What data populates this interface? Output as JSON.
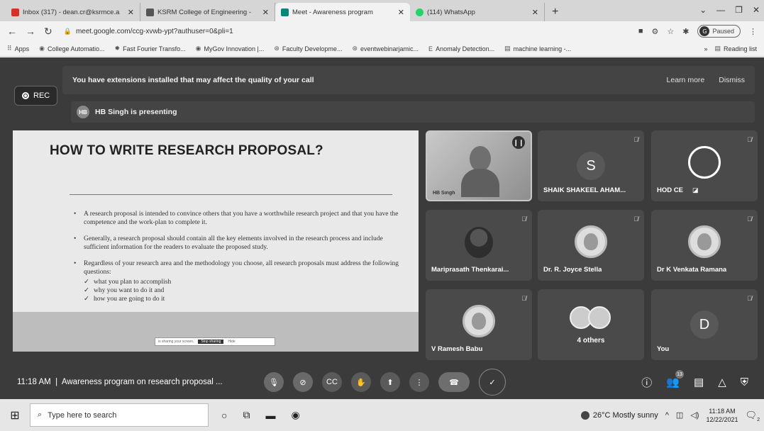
{
  "browser": {
    "tabs": [
      {
        "title": "Inbox (317) - dean.cr@ksrmce.a",
        "favicon_color": "#d93025"
      },
      {
        "title": "KSRM College of Engineering -",
        "favicon_color": "#555555"
      },
      {
        "title": "Meet - Awareness program",
        "favicon_color": "#00897b"
      },
      {
        "title": "(114) WhatsApp",
        "favicon_color": "#25d366"
      }
    ],
    "url": "meet.google.com/ccg-xvwb-ypt?authuser=0&pli=1",
    "profile_status": "Paused",
    "profile_initial": "G",
    "bookmarks": [
      {
        "label": "Apps"
      },
      {
        "label": "College Automatio..."
      },
      {
        "label": "Fast Fourier Transfo..."
      },
      {
        "label": "MyGov Innovation |..."
      },
      {
        "label": "Faculty Developme..."
      },
      {
        "label": "eventwebinarjamic..."
      },
      {
        "label": "Anomaly Detection..."
      },
      {
        "label": "machine learning -..."
      }
    ],
    "reading_list": "Reading list"
  },
  "meet": {
    "ext_banner": {
      "message": "You have extensions installed that may affect the quality of your call",
      "learn_more": "Learn more",
      "dismiss": "Dismiss"
    },
    "rec_label": "REC",
    "presenter": {
      "initials": "HB",
      "text": "HB Singh is presenting"
    },
    "slide": {
      "title": "HOW TO WRITE RESEARCH PROPOSAL?",
      "points": [
        "A research proposal is intended to convince others that you have a worthwhile research project and that you have the competence and the work-plan to complete it.",
        "Generally, a research proposal should contain all the key elements involved in the research process and include sufficient information for the readers to evaluate the proposed study.",
        "Regardless of your research area and the methodology you choose, all research proposals must address the following questions:"
      ],
      "subpoints": [
        "what you plan to accomplish",
        "why you want to do it and",
        "how you are going to do it"
      ],
      "share_bar": {
        "text": "is sharing your screen.",
        "stop": "Stop sharing",
        "hide": "Hide"
      }
    },
    "participants": [
      {
        "name": "HB Singh",
        "type": "video"
      },
      {
        "name": "SHAIK SHAKEEL AHAM...",
        "type": "letter",
        "letter": "S"
      },
      {
        "name": "HOD CE",
        "type": "logo"
      },
      {
        "name": "Mariprasath Thenkarai...",
        "type": "photo"
      },
      {
        "name": "Dr. R. Joyce Stella",
        "type": "seal"
      },
      {
        "name": "Dr K Venkata Ramana",
        "type": "seal"
      },
      {
        "name": "V Ramesh Babu",
        "type": "seal"
      },
      {
        "name": "4 others",
        "type": "group"
      },
      {
        "name": "You",
        "type": "letter",
        "letter": "D"
      }
    ],
    "time": "11:18 AM",
    "meeting_title": "Awareness program on research proposal ...",
    "participant_count": "13"
  },
  "taskbar": {
    "search_placeholder": "Type here to search",
    "weather": "26°C Mostly sunny",
    "time": "11:18 AM",
    "date": "12/22/2021",
    "notification_count": "2"
  }
}
